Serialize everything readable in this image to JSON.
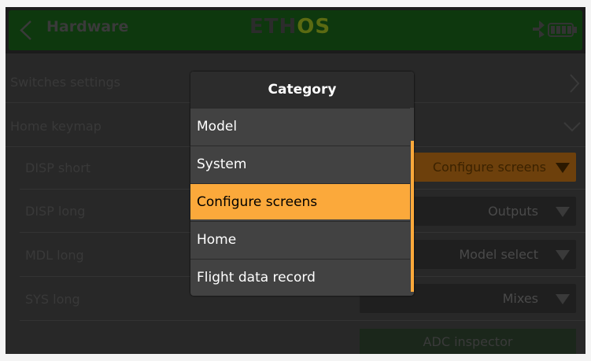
{
  "header": {
    "title": "Hardware",
    "logo_main": "ETH",
    "logo_accent": "OS"
  },
  "rows": [
    {
      "label": "Switches settings"
    },
    {
      "label": "Home keymap"
    }
  ],
  "keymap": [
    {
      "label": "DISP short",
      "value": "Configure screens"
    },
    {
      "label": "DISP long",
      "value": "Outputs"
    },
    {
      "label": "MDL long",
      "value": "Model select"
    },
    {
      "label": "SYS long",
      "value": "Mixes"
    }
  ],
  "adc_button": "ADC inspector",
  "modal": {
    "title": "Category",
    "options": [
      "Model",
      "System",
      "Configure screens",
      "Home",
      "Flight data record"
    ],
    "selected": "Configure screens"
  },
  "colors": {
    "accent": "#fba93b",
    "header_green": "#0e380e"
  },
  "icons": [
    "back-icon",
    "bluetooth-icon",
    "battery-icon",
    "chevron-right-icon",
    "chevron-down-icon",
    "dropdown-triangle-icon"
  ]
}
